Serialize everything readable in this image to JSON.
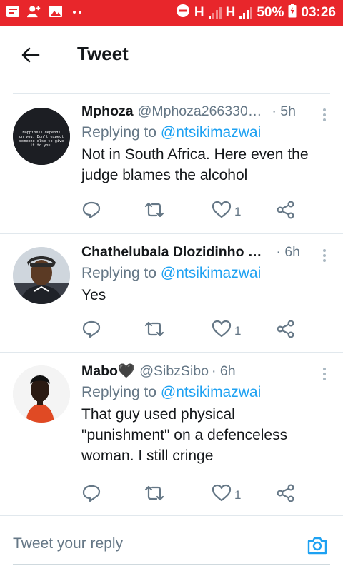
{
  "status_bar": {
    "network_label": "H",
    "network_label_2": "H",
    "battery": "50%",
    "time": "03:26"
  },
  "header": {
    "title": "Tweet"
  },
  "tweets": [
    {
      "name": "Mphoza",
      "handle": "@Mphoza266330…",
      "time": "· 5h",
      "replying_prefix": "Replying to ",
      "replying_to": "@ntsikimazwai",
      "text": "Not in South Africa. Here even the judge blames the alcohol",
      "likes": "1",
      "avatar_text": "Happiness depends on you. Don't expect someone else to give it to you."
    },
    {
      "name": "Chathelubala Dlozidinho …",
      "handle": "",
      "time": "· 6h",
      "replying_prefix": "Replying to ",
      "replying_to": "@ntsikimazwai",
      "text": "Yes",
      "likes": "1"
    },
    {
      "name": "Mabo🖤",
      "handle": "@SibzSibo",
      "time": "· 6h",
      "replying_prefix": "Replying to ",
      "replying_to": "@ntsikimazwai",
      "text": "That guy used physical \"punishment\" on a defenceless woman. I still cringe",
      "likes": "1"
    }
  ],
  "composer": {
    "placeholder": "Tweet your reply"
  },
  "colors": {
    "status_bar": "#e8262b",
    "accent": "#1da1f2",
    "secondary_text": "#657786"
  }
}
